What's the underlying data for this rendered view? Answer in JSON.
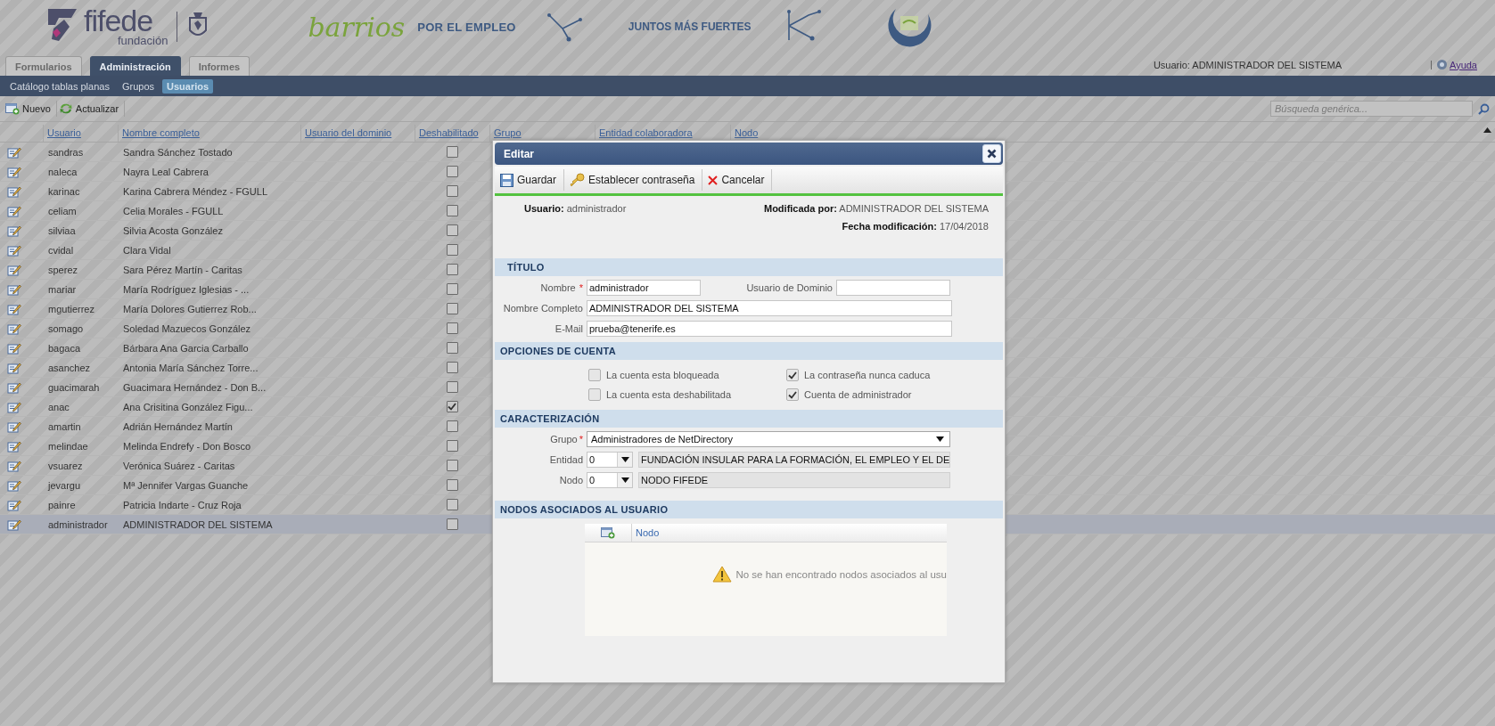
{
  "header": {
    "logo_title": "fifede",
    "logo_subtitle": "fundación",
    "campaign_script": "barrios",
    "campaign_tagline": "POR EL EMPLEO",
    "campaign_motto": "JUNTOS MÁS FUERTES"
  },
  "tabs": [
    {
      "label": "Formularios",
      "selected": false
    },
    {
      "label": "Administración",
      "selected": true
    },
    {
      "label": "Informes",
      "selected": false
    }
  ],
  "user_label": "Usuario: ADMINISTRADOR DEL SISTEMA",
  "help_link": "Ayuda",
  "subnav": [
    {
      "label": "Catálogo tablas planas",
      "selected": false
    },
    {
      "label": "Grupos",
      "selected": false
    },
    {
      "label": "Usuarios",
      "selected": true
    }
  ],
  "toolbar": {
    "buttons": [
      {
        "label": "Nuevo",
        "kind": "new"
      },
      {
        "label": "Actualizar",
        "kind": "refresh"
      }
    ],
    "search": {
      "placeholder": "Búsqueda genérica..."
    }
  },
  "table": {
    "columns": [
      "Usuario",
      "Nombre completo",
      "Usuario del dominio",
      "Deshabilitado",
      "Grupo",
      "Entidad colaboradora",
      "Nodo"
    ],
    "rows": [
      {
        "user": "sandras",
        "name": "Sandra Sánchez Tostado",
        "disabled": false,
        "selected": false
      },
      {
        "user": "naleca",
        "name": "Nayra Leal Cabrera",
        "disabled": false,
        "selected": false
      },
      {
        "user": "karinac",
        "name": "Karina Cabrera Méndez - FGULL",
        "disabled": false,
        "selected": false
      },
      {
        "user": "celiam",
        "name": "Celia Morales - FGULL",
        "disabled": false,
        "selected": false
      },
      {
        "user": "silviaa",
        "name": "Silvia Acosta González",
        "disabled": false,
        "selected": false
      },
      {
        "user": "cvidal",
        "name": "Clara Vidal",
        "disabled": false,
        "selected": false
      },
      {
        "user": "sperez",
        "name": "Sara Pérez Martín - Caritas",
        "disabled": false,
        "selected": false
      },
      {
        "user": "mariar",
        "name": "María Rodríguez Iglesias - ...",
        "disabled": false,
        "selected": false
      },
      {
        "user": "mgutierrez",
        "name": "María Dolores Gutierrez Rob...",
        "disabled": false,
        "selected": false
      },
      {
        "user": "somago",
        "name": "Soledad Mazuecos González",
        "disabled": false,
        "selected": false
      },
      {
        "user": "bagaca",
        "name": "Bárbara Ana Garcia Carballo",
        "disabled": false,
        "selected": false
      },
      {
        "user": "asanchez",
        "name": "Antonia María Sánchez Torre...",
        "disabled": false,
        "selected": false
      },
      {
        "user": "guacimarah",
        "name": "Guacimara Hernández - Don B...",
        "disabled": false,
        "selected": false
      },
      {
        "user": "anac",
        "name": "Ana Crisitina González Figu...",
        "disabled": true,
        "selected": false
      },
      {
        "user": "amartin",
        "name": "Adrián Hernández Martín",
        "disabled": false,
        "selected": false
      },
      {
        "user": "melindae",
        "name": "Melinda Endrefy - Don Bosco",
        "disabled": false,
        "selected": false
      },
      {
        "user": "vsuarez",
        "name": "Verónica Suárez - Caritas",
        "disabled": false,
        "selected": false
      },
      {
        "user": "jevargu",
        "name": "Mª Jennifer Vargas Guanche",
        "disabled": false,
        "selected": false
      },
      {
        "user": "painre",
        "name": "Patricia Indarte - Cruz Roja",
        "disabled": false,
        "selected": false
      },
      {
        "user": "administrador",
        "name": "ADMINISTRADOR DEL SISTEMA",
        "disabled": false,
        "selected": true
      }
    ]
  },
  "dialog": {
    "title": "Editar",
    "buttons": [
      {
        "label": "Guardar",
        "kind": "save"
      },
      {
        "label": "Establecer contraseña",
        "kind": "key"
      },
      {
        "label": "Cancelar",
        "kind": "cancel"
      }
    ],
    "info": {
      "user_label": "Usuario:",
      "user_value": "administrador",
      "modified_label": "Modificada por:",
      "modified_value": "ADMINISTRADOR DEL SISTEMA",
      "date_label": "Fecha modificación:",
      "date_value": "17/04/2018"
    },
    "title_section": {
      "heading": "TÍTULO",
      "name": {
        "label": "Nombre",
        "required_mark": "*",
        "value": "administrador"
      },
      "domain_user": {
        "label": "Usuario de Dominio"
      },
      "full_name": {
        "label": "Nombre Completo",
        "value": "ADMINISTRADOR DEL SISTEMA"
      },
      "email": {
        "label": "E-Mail",
        "value": "prueba@tenerife.es"
      }
    },
    "account_options": {
      "heading": "OPCIONES DE CUENTA",
      "options": [
        {
          "label": "La cuenta esta bloqueada",
          "checked": false
        },
        {
          "label": "La contraseña nunca caduca",
          "checked": true
        },
        {
          "label": "La cuenta esta deshabilitada",
          "checked": false
        },
        {
          "label": "Cuenta de administrador",
          "checked": true
        }
      ]
    },
    "characterization": {
      "heading": "CARACTERIZACIÓN",
      "group": {
        "label": "Grupo",
        "required_mark": "*",
        "value": "Administradores de NetDirectory"
      },
      "entity": {
        "label": "Entidad",
        "code": "0",
        "name": "FUNDACIÓN INSULAR PARA LA FORMACIÓN, EL EMPLEO Y EL DE"
      },
      "node": {
        "label": "Nodo",
        "code": "0",
        "name": "NODO FIFEDE"
      }
    },
    "nodes": {
      "heading": "NODOS ASOCIADOS AL USUARIO",
      "column": "Nodo",
      "empty_message": "No se han encontrado nodos asociados al usu"
    }
  }
}
